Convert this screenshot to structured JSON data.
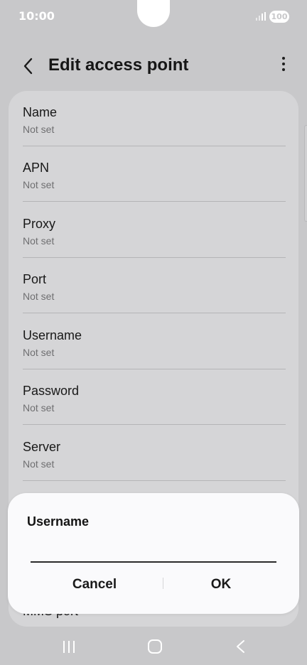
{
  "status_bar": {
    "time": "10:00",
    "battery": "100"
  },
  "header": {
    "title": "Edit access point",
    "back_icon": "chevron-left-icon",
    "more_icon": "more-vertical-icon"
  },
  "settings": {
    "rows": [
      {
        "title": "Name",
        "value": "Not set"
      },
      {
        "title": "APN",
        "value": "Not set"
      },
      {
        "title": "Proxy",
        "value": "Not set"
      },
      {
        "title": "Port",
        "value": "Not set"
      },
      {
        "title": "Username",
        "value": "Not set"
      },
      {
        "title": "Password",
        "value": "Not set"
      },
      {
        "title": "Server",
        "value": "Not set"
      }
    ],
    "partial_row_title": "MMS port"
  },
  "dialog": {
    "title": "Username",
    "input_value": "",
    "cancel_label": "Cancel",
    "ok_label": "OK"
  },
  "nav_bar": {
    "recents_icon": "recents-icon",
    "home_icon": "home-icon",
    "back_icon": "back-icon"
  },
  "colors": {
    "background": "#c8c8ca",
    "card": "#d5d5d7",
    "dialog": "#fafafc",
    "text_primary": "#181818",
    "text_secondary": "#6f6f71"
  }
}
